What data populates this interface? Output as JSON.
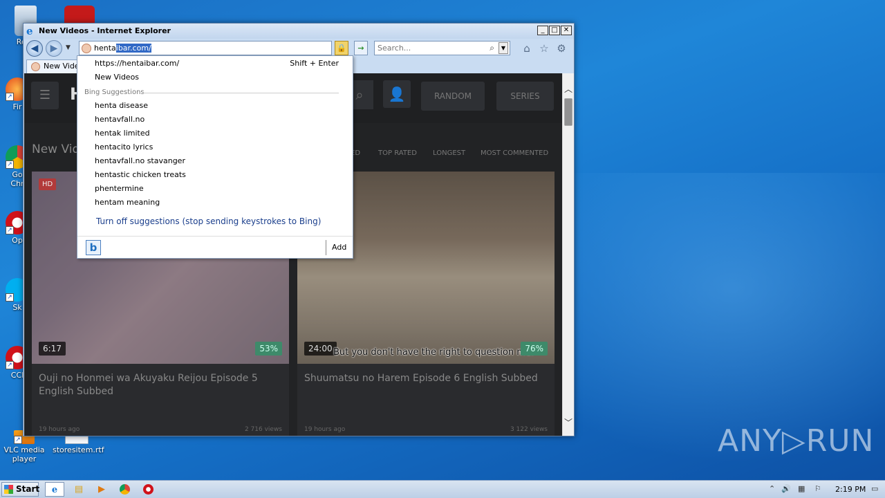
{
  "desktop": {
    "icons": [
      {
        "label": "Recy"
      },
      {
        "label": "Fir"
      },
      {
        "label": "Go\nChr"
      },
      {
        "label": "Op"
      },
      {
        "label": "Sk"
      },
      {
        "label": "CCl"
      },
      {
        "label": "VLC media player"
      },
      {
        "label": "storesitem.rtf"
      }
    ]
  },
  "window": {
    "title": "New Videos - Internet Explorer",
    "minimize": "_",
    "maximize": "□",
    "close": "✕"
  },
  "addressbar": {
    "typed_plain": "henta",
    "typed_selected": "ibar.com/"
  },
  "searchbox": {
    "placeholder": "Search..."
  },
  "tab": {
    "label": "New Videos"
  },
  "autocomplete": {
    "url_suggestion": "https://hentaibar.com/",
    "url_shortcut": "Shift + Enter",
    "history_item": "New Videos",
    "bing_heading": "Bing Suggestions",
    "suggestions": [
      "henta disease",
      "hentavfall.no",
      "hentak limited",
      "hentacito lyrics",
      "hentavfall.no stavanger",
      "hentastic chicken treats",
      "phentermine",
      "hentam meaning"
    ],
    "turn_off": "Turn off suggestions (stop sending keystrokes to Bing)",
    "add_label": "Add"
  },
  "site": {
    "logo": "H",
    "nav": {
      "random": "RANDOM",
      "series": "SERIES"
    },
    "section_title": "New Vid",
    "filters": [
      "ED",
      "TOP RATED",
      "LONGEST",
      "MOST COMMENTED"
    ],
    "videos": [
      {
        "badge": "HD",
        "duration": "6:17",
        "rating": "53%",
        "subtitle": "",
        "title": "Ouji no Honmei wa Akuyaku Reijou Episode 5 English Subbed",
        "age": "19 hours ago",
        "views": "2 716 views"
      },
      {
        "badge": "",
        "duration": "24:00",
        "rating": "76%",
        "subtitle": "But you don't have the right to question me.",
        "title": "Shuumatsu no Harem Episode 6 English Subbed",
        "age": "19 hours ago",
        "views": "3 122 views"
      }
    ]
  },
  "watermark": "ANY▷RUN",
  "taskbar": {
    "start_label": "Start",
    "clock": "2:19 PM"
  },
  "colors": {
    "desktop": "#1a6fc4",
    "ie_frame": "#c9dcf2",
    "site_bg": "#222325",
    "hd_badge": "#b23a3a",
    "rating_badge": "#3e8a6a"
  }
}
